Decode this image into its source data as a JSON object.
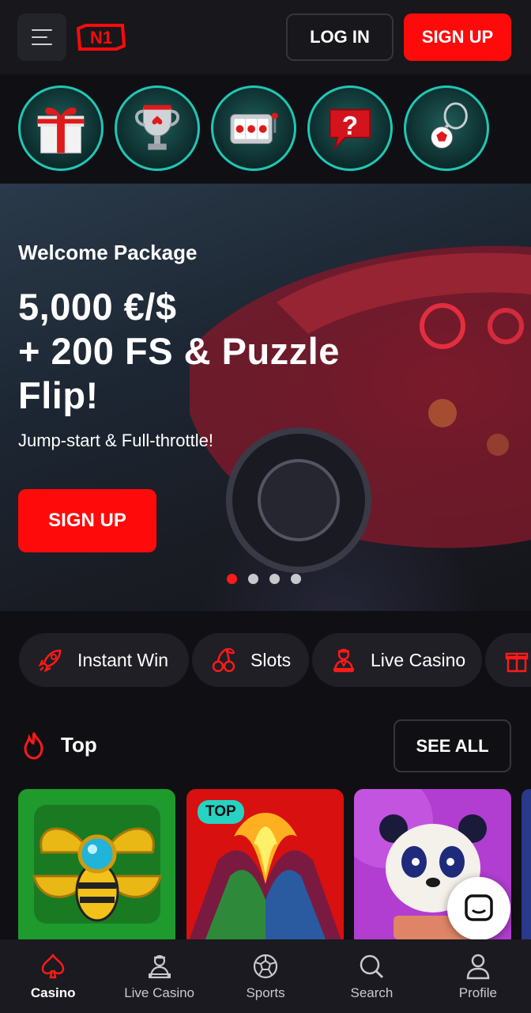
{
  "header": {
    "login_label": "LOG IN",
    "signup_label": "SIGN UP",
    "logo_text": "N1"
  },
  "stories": [
    {
      "icon": "gift-icon"
    },
    {
      "icon": "trophy-icon"
    },
    {
      "icon": "slot-machine-icon"
    },
    {
      "icon": "question-bubble-icon"
    },
    {
      "icon": "tennis-football-icon"
    }
  ],
  "banner": {
    "subtitle": "Welcome Package",
    "title_line1": "5,000 €/$",
    "title_line2": "+ 200 FS & Puzzle",
    "title_line3": "Flip!",
    "description": "Jump-start & Full-throttle!",
    "cta_label": "SIGN UP",
    "slides_total": 4,
    "active_slide": 1
  },
  "categories": [
    {
      "label": "Instant Win",
      "icon": "rocket-icon"
    },
    {
      "label": "Slots",
      "icon": "cherries-icon"
    },
    {
      "label": "Live Casino",
      "icon": "dealer-icon"
    },
    {
      "label": "",
      "icon": "gift-box-icon"
    }
  ],
  "top_section": {
    "title": "Top",
    "see_all_label": "SEE ALL",
    "games": [
      {
        "badge": ""
      },
      {
        "badge": "TOP"
      },
      {
        "badge": ""
      }
    ]
  },
  "bottom_nav": {
    "items": [
      {
        "label": "Casino",
        "icon": "spade-icon",
        "active": true
      },
      {
        "label": "Live Casino",
        "icon": "dealer-icon",
        "active": false
      },
      {
        "label": "Sports",
        "icon": "soccer-ball-icon",
        "active": false
      },
      {
        "label": "Search",
        "icon": "search-icon",
        "active": false
      },
      {
        "label": "Profile",
        "icon": "user-icon",
        "active": false
      }
    ]
  },
  "colors": {
    "accent": "#ff0a0a",
    "teal": "#20c6b6",
    "background": "#101014"
  }
}
